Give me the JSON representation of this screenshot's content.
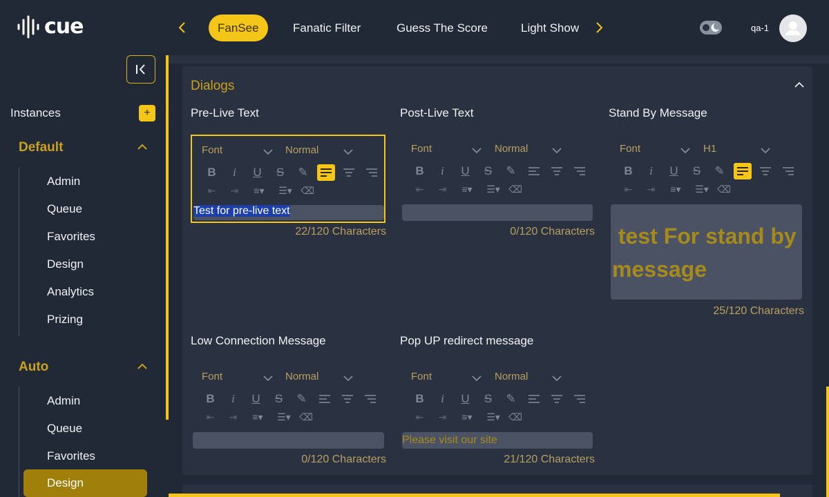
{
  "brand": {
    "logo_text": "cue"
  },
  "header": {
    "tabs": [
      {
        "label": "FanSee"
      },
      {
        "label": "Fanatic Filter"
      },
      {
        "label": "Guess The Score"
      },
      {
        "label": "Light Show"
      }
    ],
    "user": "qa-1",
    "colors": {
      "accent": "#f5c518",
      "background": "#212836",
      "panel": "#2a3140"
    }
  },
  "sidebar": {
    "instances_label": "Instances",
    "add_label": "+",
    "groups": [
      {
        "title": "Default",
        "items": [
          {
            "label": "Admin"
          },
          {
            "label": "Queue"
          },
          {
            "label": "Favorites"
          },
          {
            "label": "Design"
          },
          {
            "label": "Analytics"
          },
          {
            "label": "Prizing"
          }
        ]
      },
      {
        "title": "Auto",
        "items": [
          {
            "label": "Admin"
          },
          {
            "label": "Queue"
          },
          {
            "label": "Favorites"
          },
          {
            "label": "Design"
          }
        ]
      }
    ]
  },
  "panel": {
    "title": "Dialogs",
    "fields": [
      {
        "label": "Pre-Live Text",
        "font": "Font",
        "size": "Normal",
        "text": "Test for pre-live text",
        "counter": "22/120 Characters"
      },
      {
        "label": "Post-Live Text",
        "font": "Font",
        "size": "Normal",
        "text": "",
        "counter": "0/120 Characters"
      },
      {
        "label": "Stand By Message",
        "font": "Font",
        "size": "H1",
        "text": " test For stand by message",
        "counter": "25/120 Characters"
      },
      {
        "label": "Low Connection Message",
        "font": "Font",
        "size": "Normal",
        "text": "",
        "counter": "0/120 Characters"
      },
      {
        "label": "Pop UP redirect message",
        "font": "Font",
        "size": "Normal",
        "text": "Please visit our site",
        "counter": "21/120 Characters"
      }
    ]
  }
}
